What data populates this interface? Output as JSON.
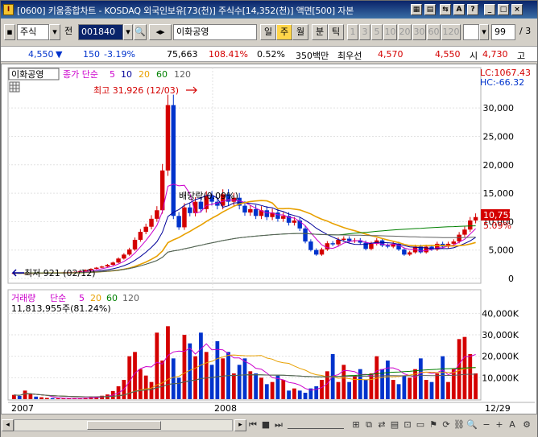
{
  "window": {
    "title": "[0600] 키움종합차트 - KOSDAQ 외국인보유[73(천)] 주식수[14,352(천)] 액면[500] 자본",
    "icon": "kiwoom-app-icon"
  },
  "toolbar": {
    "market": "주식",
    "prefix": "전",
    "code": "001840",
    "stock_name": "이화공영",
    "periods": [
      "일",
      "주",
      "월"
    ],
    "active_period": "주",
    "minute_tick": [
      "분",
      "틱"
    ],
    "intervals": [
      "1",
      "3",
      "5",
      "10",
      "20",
      "30",
      "60",
      "120"
    ],
    "count": "99",
    "count_suffix": "/ 3"
  },
  "quote": {
    "price": "4,550",
    "change": "150",
    "change_pct": "-3.19%",
    "volume": "75,663",
    "vol_ratio": "108.41%",
    "turnover": "0.52%",
    "amount": "350백만",
    "best_label": "최우선",
    "best_ask": "4,570",
    "best_bid": "4,550",
    "open_label": "시",
    "open_price": "4,730",
    "high_label": "고"
  },
  "chart_data": [
    {
      "type": "candlestick",
      "title": "",
      "stock_label": "이화공영",
      "ma_label": "종가 단순",
      "ma_periods": [
        "5",
        "10",
        "20",
        "60",
        "120"
      ],
      "ma_colors": [
        "#cc00cc",
        "#000099",
        "#e8a000",
        "#008000",
        "#606060"
      ],
      "ylim": [
        0,
        32000
      ],
      "y_ticks": [
        "0",
        "5,000",
        "10,000",
        "15,000",
        "20,000",
        "25,000",
        "30,000"
      ],
      "y_tick_values": [
        0,
        5000,
        10000,
        15000,
        20000,
        25000,
        30000
      ],
      "lc": "LC:1067.43",
      "hc": "HC:-66.32",
      "current_price_tag": "10,752",
      "current_pct_tag": "5.09%",
      "annotations": {
        "high": "최고 31,926 (12/03)",
        "low": "최저 921 (02/12)",
        "dividend": "배당락(0.09%)"
      },
      "closes": [
        950,
        930,
        940,
        960,
        950,
        980,
        1000,
        990,
        1020,
        1050,
        1100,
        1150,
        1300,
        1500,
        1700,
        1900,
        2100,
        2400,
        2800,
        3500,
        4200,
        5100,
        6800,
        8200,
        9100,
        10500,
        12000,
        19000,
        30500,
        11000,
        9000,
        12500,
        11500,
        13500,
        12200,
        14500,
        13500,
        12800,
        14800,
        13500,
        14200,
        12800,
        11600,
        12200,
        11000,
        12000,
        10800,
        11600,
        10500,
        11000,
        9800,
        10200,
        8800,
        6500,
        5000,
        4200,
        5100,
        6200,
        6000,
        6800,
        7000,
        6600,
        6700,
        6300,
        5200,
        6100,
        6700,
        5800,
        5600,
        6100,
        5100,
        4200,
        4600,
        5600,
        4600,
        5600,
        5100,
        6100,
        5600,
        6100,
        6500,
        7700,
        8600,
        10200,
        10800
      ],
      "series": []
    },
    {
      "type": "bar",
      "title": "",
      "label": "거래량",
      "ma_label": "단순",
      "ma_periods": [
        "5",
        "20",
        "60",
        "120"
      ],
      "ma_colors": [
        "#cc00cc",
        "#e8a000",
        "#008000",
        "#606060"
      ],
      "info": "11,813,955주(81.24%)",
      "ylim": [
        0,
        45000
      ],
      "y_ticks": [
        "10,000K",
        "20,000K",
        "30,000K",
        "40,000K"
      ],
      "y_tick_values": [
        10000,
        20000,
        30000,
        40000
      ],
      "values": [
        2000,
        1500,
        4000,
        2500,
        1200,
        900,
        600,
        500,
        400,
        300,
        350,
        400,
        500,
        700,
        900,
        1200,
        1600,
        2200,
        3800,
        6000,
        9000,
        20000,
        22000,
        14000,
        11000,
        8000,
        31000,
        18000,
        34000,
        19000,
        10000,
        30000,
        26000,
        20000,
        31000,
        22000,
        16000,
        27000,
        19000,
        22000,
        12000,
        16000,
        19000,
        13000,
        12000,
        10000,
        7000,
        8000,
        11000,
        9000,
        4000,
        5000,
        4000,
        3000,
        5000,
        6000,
        9000,
        13000,
        21000,
        8000,
        16000,
        8000,
        11000,
        14000,
        9000,
        12000,
        20000,
        14000,
        18000,
        9000,
        7000,
        11000,
        10000,
        14000,
        19000,
        9000,
        8000,
        12000,
        20000,
        8000,
        14000,
        28000,
        29000,
        21000,
        12000
      ]
    }
  ],
  "x_axis": {
    "labels": [
      "2007",
      "2008",
      "12/29"
    ]
  }
}
